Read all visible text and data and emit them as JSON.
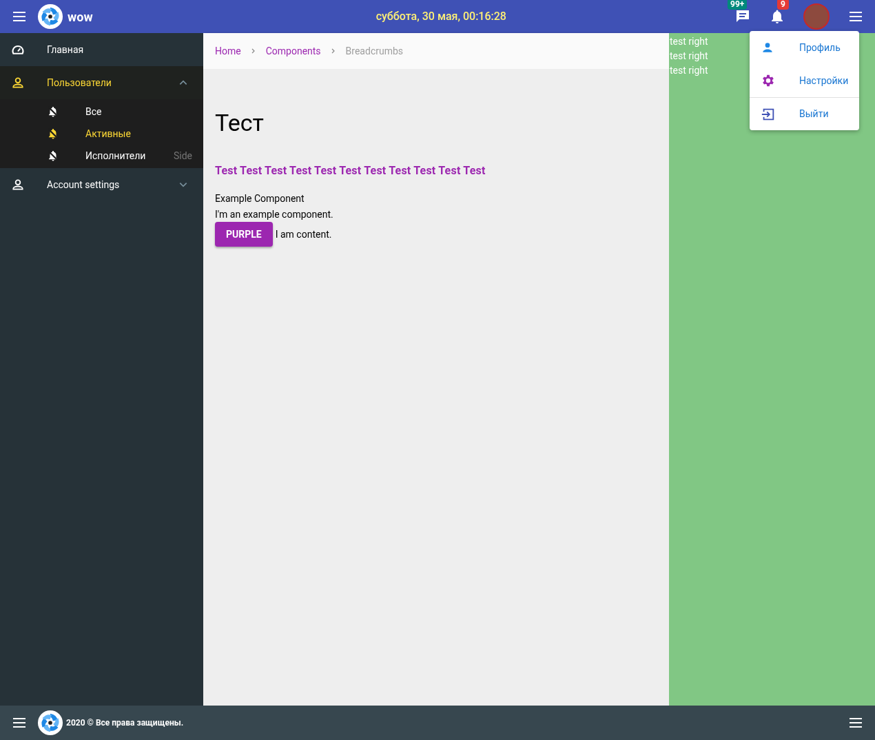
{
  "header": {
    "brand": "wow",
    "datetime": "суббота, 30 мая, 00:16:28",
    "messages_badge": "99+",
    "notifications_badge": "9"
  },
  "sidebar": {
    "items": [
      {
        "label": "Главная",
        "kind": "dashboard",
        "selected": false
      },
      {
        "label": "Пользователи",
        "kind": "group",
        "expanded": true,
        "selected": true,
        "children": [
          {
            "label": "Все",
            "selected": false
          },
          {
            "label": "Активные",
            "selected": true
          },
          {
            "label": "Исполнители",
            "selected": false,
            "note": "Side"
          }
        ]
      },
      {
        "label": "Account settings",
        "kind": "group",
        "expanded": false,
        "selected": false
      }
    ]
  },
  "breadcrumbs": [
    {
      "label": "Home",
      "current": false
    },
    {
      "label": "Components",
      "current": false
    },
    {
      "label": "Breadcrumbs",
      "current": true
    }
  ],
  "page": {
    "title": "Тест",
    "subtitle": "Test Test Test Test Test Test Test Test Test Test Test",
    "component_title": "Example Component",
    "component_text": "I'm an example component.",
    "button": "PURPLE",
    "content": "I am content."
  },
  "right_panel": {
    "lines": [
      "test right",
      "test right",
      "test right"
    ]
  },
  "user_menu": [
    {
      "label": "Профиль",
      "kind": "profile"
    },
    {
      "label": "Настройки",
      "kind": "settings"
    },
    {
      "label": "Выйти",
      "kind": "logout"
    }
  ],
  "footer": {
    "text": "2020 © Все права защищены."
  }
}
